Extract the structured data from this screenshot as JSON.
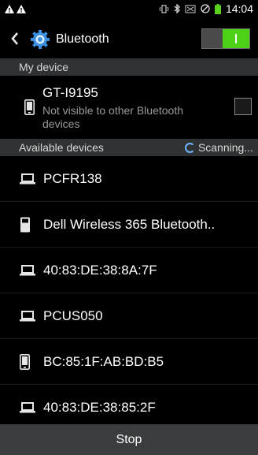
{
  "status_bar": {
    "left_icons": [
      "warning-icon",
      "warning-icon"
    ],
    "right_icons": [
      "vibrate-icon",
      "bluetooth-icon",
      "no-sim-icon",
      "blocked-icon",
      "battery-icon"
    ],
    "time": "14:04"
  },
  "action_bar": {
    "title": "Bluetooth",
    "toggle_on": true,
    "accent_color": "#4cd117"
  },
  "my_device_section": {
    "header": "My device"
  },
  "my_device": {
    "name": "GT-I9195",
    "subtitle": "Not visible to other Bluetooth devices",
    "visible_checked": false,
    "icon": "phone-icon"
  },
  "available_section": {
    "header": "Available devices",
    "status": "Scanning..."
  },
  "devices": [
    {
      "label": "PCFR138",
      "icon": "laptop-icon"
    },
    {
      "label": "Dell Wireless 365 Bluetooth..",
      "icon": "device-icon"
    },
    {
      "label": "40:83:DE:38:8A:7F",
      "icon": "laptop-icon"
    },
    {
      "label": "PCUS050",
      "icon": "laptop-icon"
    },
    {
      "label": "BC:85:1F:AB:BD:B5",
      "icon": "phone-icon"
    },
    {
      "label": "40:83:DE:38:85:2F",
      "icon": "laptop-icon"
    }
  ],
  "bottom_button": {
    "label": "Stop"
  }
}
